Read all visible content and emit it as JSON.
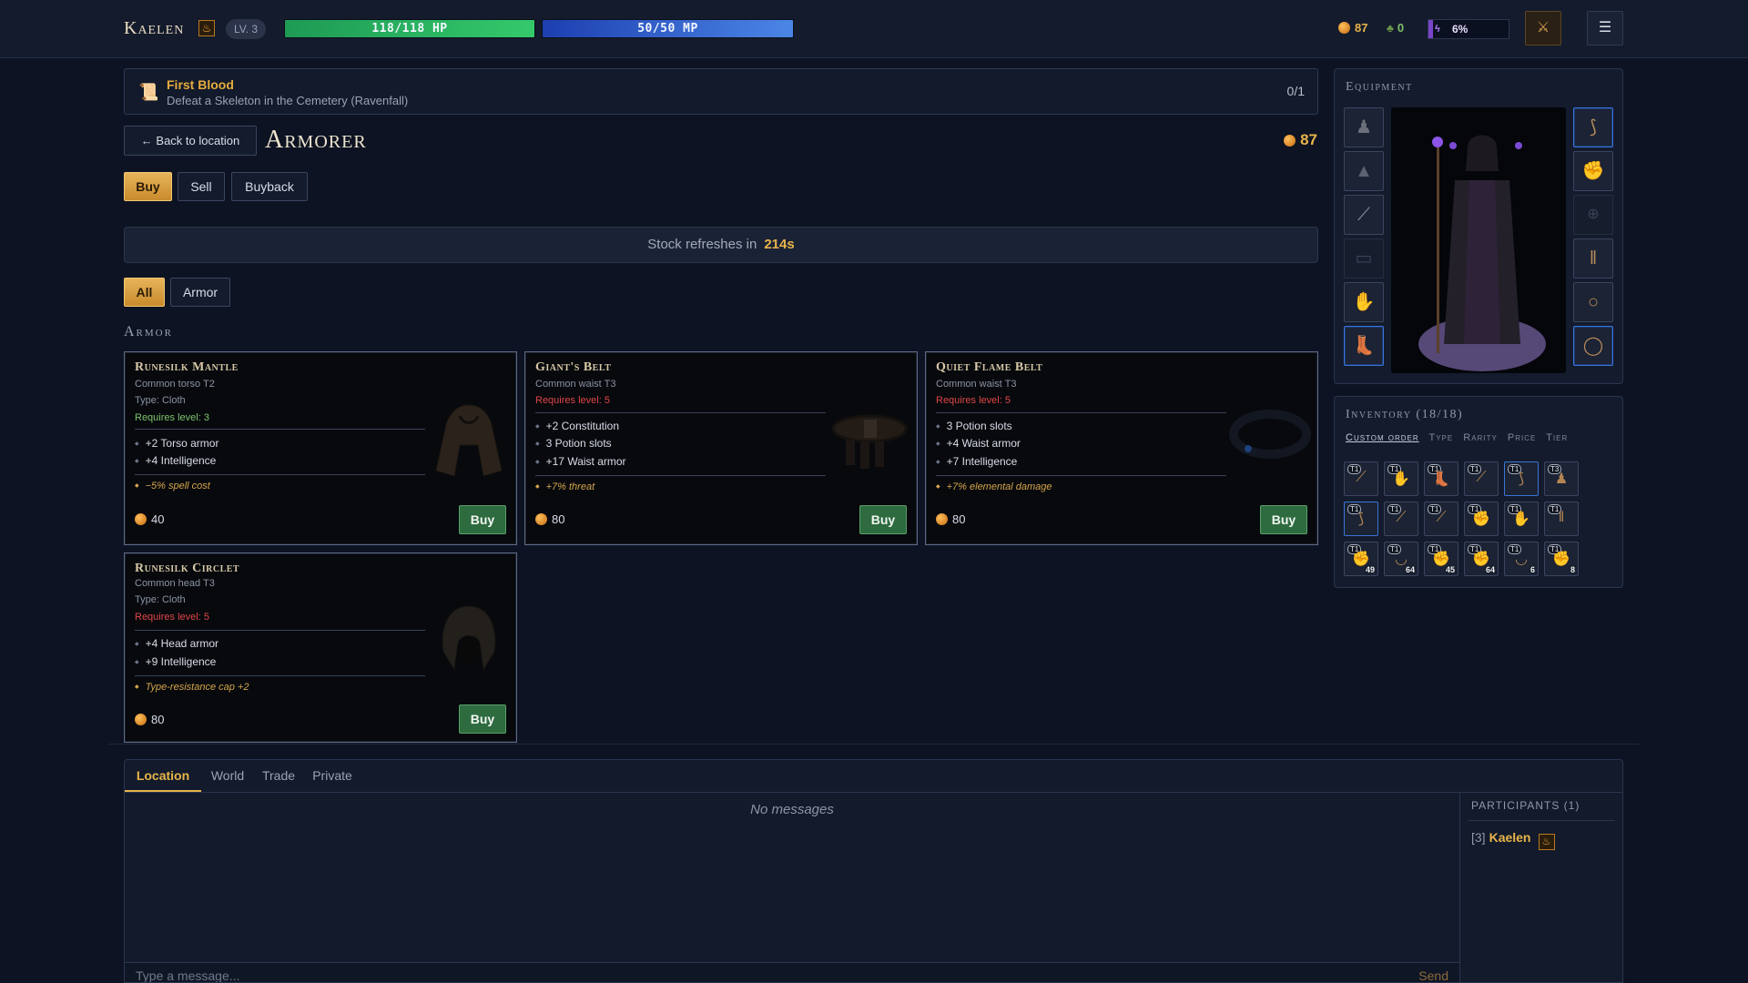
{
  "player": {
    "name": "Kaelen",
    "class_icon": "flame-class-icon",
    "level": "LV. 3",
    "hp_text": "118/118 HP",
    "hp_fraction": 1.0,
    "mp_text": "50/50 MP",
    "mp_fraction": 1.0,
    "gold": "87",
    "herbs": "0",
    "xp_text": "6%",
    "xp_fraction": 0.06
  },
  "quest": {
    "title": "First Blood",
    "description": "Defeat a Skeleton in the Cemetery (Ravenfall)",
    "progress": "0/1"
  },
  "shop": {
    "back_label": "← Back to location",
    "title": "Armorer",
    "gold": "87",
    "modes": [
      "Buy",
      "Sell",
      "Buyback"
    ],
    "active_mode": "Buy",
    "refresh_label": "Stock refreshes in",
    "refresh_time": "214s",
    "filters": [
      "All",
      "Armor"
    ],
    "active_filter": "All",
    "section": "Armor"
  },
  "items": [
    {
      "name": "Runesilk Mantle",
      "sub": "Common torso T2",
      "type": "Type: Cloth",
      "req": "Requires level: 3",
      "req_met": true,
      "stats": [
        "+2 Torso armor",
        "+4 Intelligence"
      ],
      "affix": "−5% spell cost",
      "price": "40",
      "buy_label": "Buy"
    },
    {
      "name": "Giant's Belt",
      "sub": "Common waist T3",
      "type": "",
      "req": "Requires level: 5",
      "req_met": false,
      "stats": [
        "+2 Constitution",
        "3 Potion slots",
        "+17 Waist armor"
      ],
      "affix": "+7% threat",
      "price": "80",
      "buy_label": "Buy"
    },
    {
      "name": "Quiet Flame Belt",
      "sub": "Common waist T3",
      "type": "",
      "req": "Requires level: 5",
      "req_met": false,
      "stats": [
        "3 Potion slots",
        "+4 Waist armor",
        "+7 Intelligence"
      ],
      "affix": "+7% elemental damage",
      "price": "80",
      "buy_label": "Buy"
    },
    {
      "name": "Runesilk Circlet",
      "sub": "Common head T3",
      "type": "Type: Cloth",
      "req": "Requires level: 5",
      "req_met": false,
      "stats": [
        "+4 Head armor",
        "+9 Intelligence"
      ],
      "affix": "Type-resistance cap +2",
      "price": "80",
      "buy_label": "Buy"
    }
  ],
  "equipment": {
    "title": "Equipment",
    "left_slots": [
      "helmet-icon",
      "robe-icon",
      "staff-icon",
      "empty-belt-slot",
      "gloves-icon",
      "boots-icon"
    ],
    "right_slots": [
      "horn-icon",
      "gauntlet-icon",
      "empty-slot-icon",
      "bracers-icon",
      "ring-icon",
      "ring-icon"
    ]
  },
  "inventory": {
    "title": "Inventory (18/18)",
    "sort_options": [
      "Custom order",
      "Type",
      "Rarity",
      "Price",
      "Tier"
    ],
    "active_sort": "Custom order",
    "slots": [
      {
        "tier": "T1",
        "qty": ""
      },
      {
        "tier": "T1",
        "qty": ""
      },
      {
        "tier": "T1",
        "qty": ""
      },
      {
        "tier": "T1",
        "qty": ""
      },
      {
        "tier": "T1",
        "qty": ""
      },
      {
        "tier": "T3",
        "qty": ""
      },
      {
        "tier": "T1",
        "qty": ""
      },
      {
        "tier": "T1",
        "qty": ""
      },
      {
        "tier": "T1",
        "qty": ""
      },
      {
        "tier": "T1",
        "qty": ""
      },
      {
        "tier": "T1",
        "qty": ""
      },
      {
        "tier": "T1",
        "qty": ""
      },
      {
        "tier": "T1",
        "qty": "49"
      },
      {
        "tier": "T1",
        "qty": "64"
      },
      {
        "tier": "T1",
        "qty": "45"
      },
      {
        "tier": "T1",
        "qty": "64"
      },
      {
        "tier": "T1",
        "qty": "6"
      },
      {
        "tier": "T1",
        "qty": "8"
      }
    ]
  },
  "chat": {
    "tabs": [
      "Location",
      "World",
      "Trade",
      "Private"
    ],
    "active_tab": "Location",
    "empty_text": "No messages",
    "input_placeholder": "Type a message...",
    "send_label": "Send",
    "participants_title": "PARTICIPANTS (1)",
    "participants": [
      {
        "level": "[3]",
        "name": "Kaelen"
      }
    ]
  },
  "colors": {
    "gold": "#e8b44a",
    "hp": "#34c96b",
    "mp": "#4b86e6",
    "xp": "#7a45c8",
    "requirement_unmet": "#e04646",
    "requirement_met": "#7cc46a"
  }
}
